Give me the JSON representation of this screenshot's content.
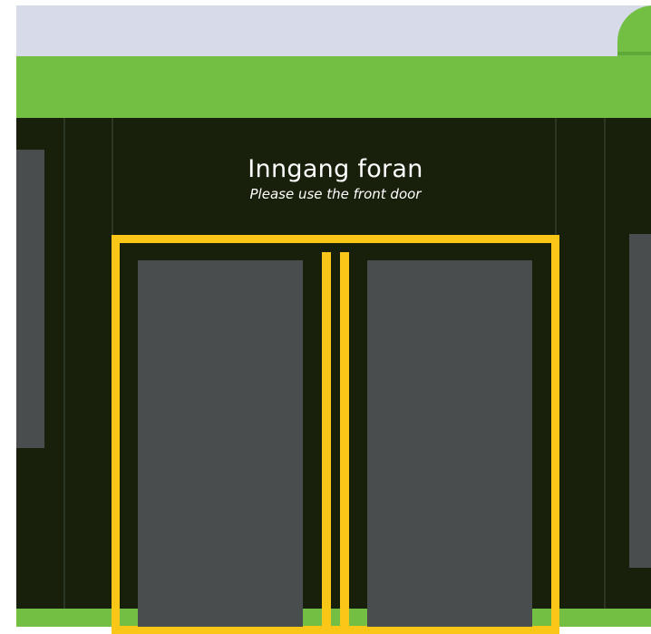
{
  "sign": {
    "title": "Inngang foran",
    "subtitle": "Please use the front door"
  },
  "colors": {
    "sky": "#d7dbe9",
    "bus_green": "#72bf44",
    "bus_body": "#18200c",
    "window_glass": "#494d4d",
    "door_frame_yellow": "#fac617",
    "text": "#ffffff"
  }
}
